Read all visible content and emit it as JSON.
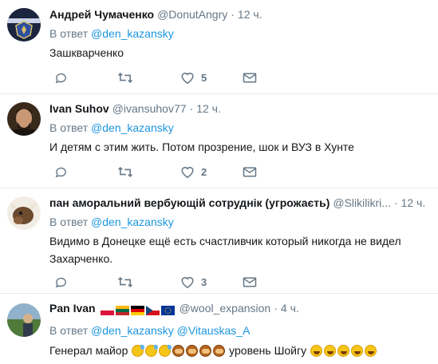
{
  "tweets": [
    {
      "name": "Андрей Чумаченко",
      "handle": "@DonutAngry",
      "time": "12 ч.",
      "reply_prefix": "В ответ",
      "reply_to": "@den_kazansky",
      "text": "Зашкварченко",
      "likes": "5"
    },
    {
      "name": "Ivan Suhov",
      "handle": "@ivansuhov77",
      "time": "12 ч.",
      "reply_prefix": "В ответ",
      "reply_to": "@den_kazansky",
      "text": "И детям с этим жить. Потом прозрение, шок и ВУЗ в Хунте",
      "likes": "2"
    },
    {
      "name": "пан аморальний вербующій сотруднік (угрожаєть)",
      "handle": "@Slikilikri...",
      "time": "12 ч.",
      "reply_prefix": "В ответ",
      "reply_to": "@den_kazansky",
      "text": "Видимо в Донецке ещё есть счастливчик который никогда не видел Захарченко.",
      "likes": "3"
    },
    {
      "name": "Pan Ivan",
      "handle": "@wool_expansion",
      "time": "4 ч.",
      "reply_prefix": "В ответ",
      "reply_to": "@den_kazansky",
      "reply_to_2": "@Vitauskas_A",
      "text_start": "Генерал майор",
      "text_mid": "уровень Шойгу"
    }
  ],
  "icons": [
    "reply-icon",
    "retweet-icon",
    "like-icon",
    "direct-message-icon"
  ],
  "colors": {
    "accent": "#1b95e0",
    "muted": "#657786",
    "border": "#e6ecf0"
  }
}
